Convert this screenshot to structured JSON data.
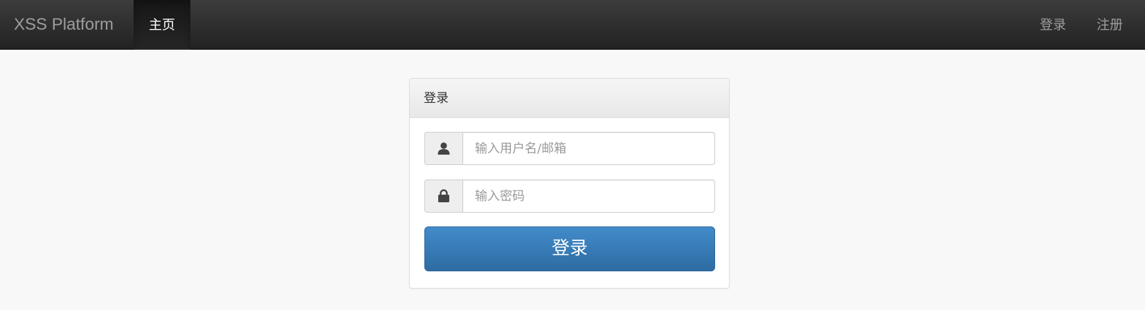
{
  "navbar": {
    "brand": "XSS Platform",
    "home": "主页",
    "login": "登录",
    "register": "注册"
  },
  "login_panel": {
    "title": "登录",
    "username_placeholder": "输入用户名/邮箱",
    "password_placeholder": "输入密码",
    "submit_label": "登录"
  },
  "icons": {
    "username": "user-icon",
    "password": "lock-icon"
  },
  "colors": {
    "navbar": "#222222",
    "primary_button": "#337ab7",
    "background": "#f8f8f8"
  }
}
